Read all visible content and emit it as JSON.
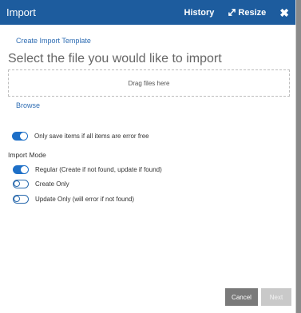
{
  "dialog": {
    "title": "Import",
    "history_label": "History",
    "resize_label": "Resize",
    "close_glyph": "✖"
  },
  "create_template_link": "Create Import Template",
  "heading": "Select the file you would like to import",
  "dropzone_text": "Drag files here",
  "browse_link": "Browse",
  "error_free_toggle": {
    "label": "Only save items if all items are error free",
    "on": true
  },
  "import_mode": {
    "label": "Import Mode",
    "options": [
      {
        "label": "Regular (Create if not found, update if found)",
        "on": true
      },
      {
        "label": "Create Only",
        "on": false
      },
      {
        "label": "Update Only (will error if not found)",
        "on": false
      }
    ]
  },
  "buttons": {
    "cancel": "Cancel",
    "next": "Next"
  },
  "colors": {
    "titlebar": "#1d5c9e",
    "toggle_on": "#1d6fc7",
    "link": "#2f6db3"
  }
}
